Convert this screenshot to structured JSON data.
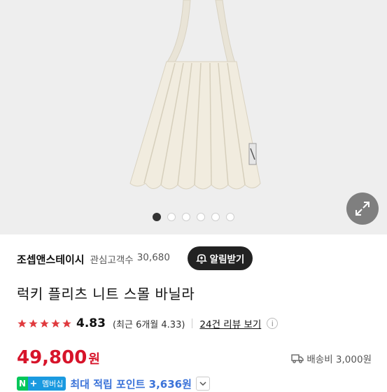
{
  "product": {
    "title": "럭키 플리츠 니트 스몰 바닐라",
    "price_value": "49,800",
    "price_unit": "원"
  },
  "gallery": {
    "image_count": 6,
    "active_index": 0
  },
  "seller": {
    "name": "조셉앤스테이시",
    "watch_label": "관심고객수",
    "watch_count": "30,680",
    "alarm_button": "알림받기"
  },
  "rating": {
    "score": "4.83",
    "recent": "(최근 6개월 4.33)",
    "review_link": "24건 리뷰 보기",
    "stars_filled": 5
  },
  "delivery": {
    "label": "배송비 3,000원"
  },
  "membership": {
    "n_label": "N",
    "plus_label": "+",
    "badge_label": "멤버십",
    "points_text": "최대 적립 포인트 3,636원"
  },
  "colors": {
    "price": "#d7142a",
    "star": "#e03a3e",
    "points": "#3b73d9",
    "naver_green": "#03c75a"
  }
}
